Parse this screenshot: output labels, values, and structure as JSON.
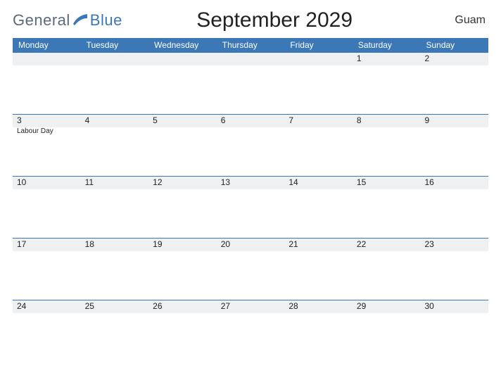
{
  "brand": {
    "general": "General",
    "blue": "Blue"
  },
  "title": "September 2029",
  "region": "Guam",
  "days": [
    "Monday",
    "Tuesday",
    "Wednesday",
    "Thursday",
    "Friday",
    "Saturday",
    "Sunday"
  ],
  "weeks": [
    [
      {
        "n": "",
        "event": ""
      },
      {
        "n": "",
        "event": ""
      },
      {
        "n": "",
        "event": ""
      },
      {
        "n": "",
        "event": ""
      },
      {
        "n": "",
        "event": ""
      },
      {
        "n": "1",
        "event": ""
      },
      {
        "n": "2",
        "event": ""
      }
    ],
    [
      {
        "n": "3",
        "event": "Labour Day"
      },
      {
        "n": "4",
        "event": ""
      },
      {
        "n": "5",
        "event": ""
      },
      {
        "n": "6",
        "event": ""
      },
      {
        "n": "7",
        "event": ""
      },
      {
        "n": "8",
        "event": ""
      },
      {
        "n": "9",
        "event": ""
      }
    ],
    [
      {
        "n": "10",
        "event": ""
      },
      {
        "n": "11",
        "event": ""
      },
      {
        "n": "12",
        "event": ""
      },
      {
        "n": "13",
        "event": ""
      },
      {
        "n": "14",
        "event": ""
      },
      {
        "n": "15",
        "event": ""
      },
      {
        "n": "16",
        "event": ""
      }
    ],
    [
      {
        "n": "17",
        "event": ""
      },
      {
        "n": "18",
        "event": ""
      },
      {
        "n": "19",
        "event": ""
      },
      {
        "n": "20",
        "event": ""
      },
      {
        "n": "21",
        "event": ""
      },
      {
        "n": "22",
        "event": ""
      },
      {
        "n": "23",
        "event": ""
      }
    ],
    [
      {
        "n": "24",
        "event": ""
      },
      {
        "n": "25",
        "event": ""
      },
      {
        "n": "26",
        "event": ""
      },
      {
        "n": "27",
        "event": ""
      },
      {
        "n": "28",
        "event": ""
      },
      {
        "n": "29",
        "event": ""
      },
      {
        "n": "30",
        "event": ""
      }
    ]
  ]
}
